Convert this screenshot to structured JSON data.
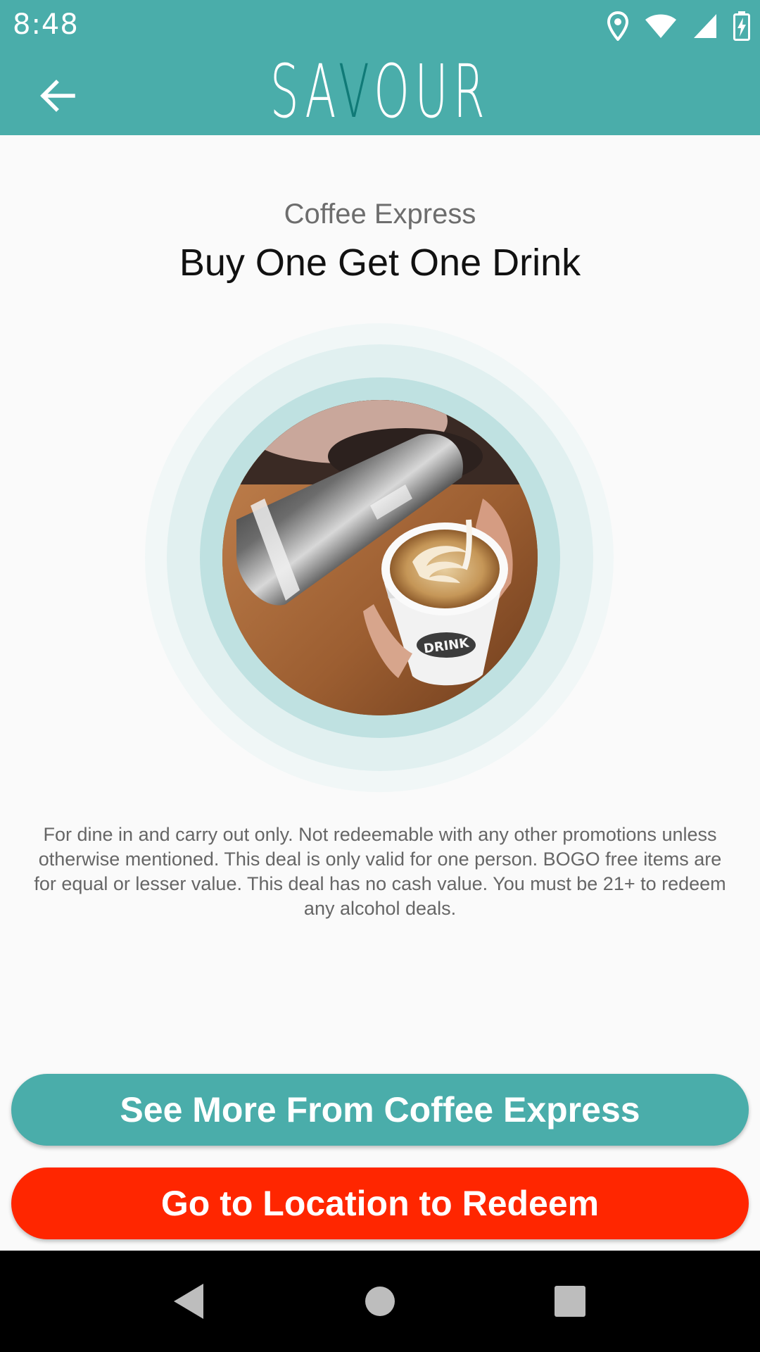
{
  "status_bar": {
    "time": "8:48",
    "icons": [
      "location-icon",
      "wifi-icon",
      "cell-signal-icon",
      "battery-charging-icon"
    ]
  },
  "app_bar": {
    "logo_before": "SA",
    "logo_accent": "V",
    "logo_after": "OUR",
    "back_icon": "arrow-left-icon"
  },
  "deal": {
    "merchant": "Coffee Express",
    "title": "Buy One Get One Drink",
    "image_description_icon": "latte-art-photo",
    "terms": "For dine in and carry out only. Not redeemable with any other promotions unless otherwise mentioned. This deal is only valid for one person. BOGO free items are for equal or lesser value. This deal has no cash value. You must be 21+ to redeem any alcohol deals.",
    "cup_label": "DRINK"
  },
  "buttons": {
    "see_more": "See More From Coffee Express",
    "redeem": "Go to Location to Redeem"
  },
  "nav_bar": {
    "icons": [
      "nav-back-icon",
      "nav-home-icon",
      "nav-recents-icon"
    ]
  },
  "colors": {
    "primary": "#4aadaa",
    "logo_accent": "#107a77",
    "redeem": "#ff2600"
  }
}
